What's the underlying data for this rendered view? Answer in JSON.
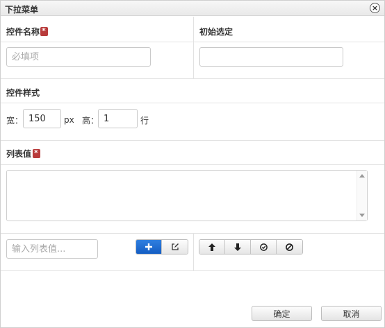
{
  "dialog": {
    "title": "下拉菜单",
    "close_icon": "close-icon"
  },
  "control_name": {
    "label": "控件名称",
    "required": true,
    "placeholder": "必填项",
    "value": ""
  },
  "initial_selection": {
    "label": "初始选定",
    "value": ""
  },
  "control_style": {
    "label": "控件样式",
    "width_label": "宽：",
    "width_value": "150",
    "width_unit": "px",
    "height_label": "高：",
    "height_value": "1",
    "height_unit": "行"
  },
  "list_values": {
    "label": "列表值",
    "required": true,
    "items": []
  },
  "list_input": {
    "placeholder": "输入列表值...",
    "value": ""
  },
  "list_actions": {
    "add_icon": "plus-icon",
    "edit_icon": "edit-icon",
    "add_color": "#1a66cc"
  },
  "order_actions": {
    "up_icon": "arrow-up-icon",
    "down_icon": "arrow-down-icon",
    "select_icon": "check-circle-icon",
    "clear_icon": "ban-icon"
  },
  "footer": {
    "ok_label": "确定",
    "cancel_label": "取消"
  }
}
